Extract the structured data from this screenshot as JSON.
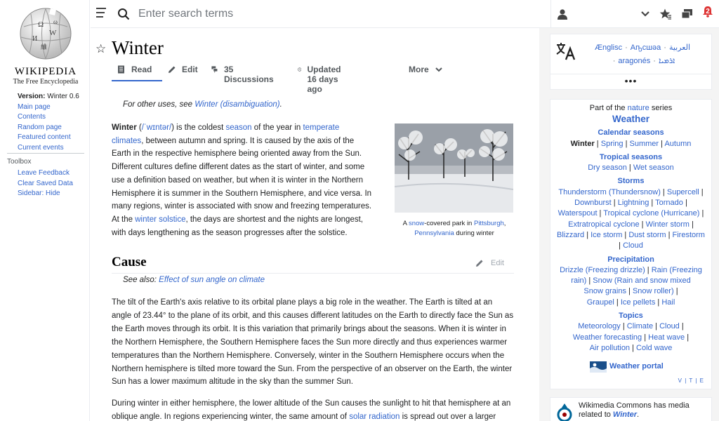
{
  "sidebar": {
    "wordmark": "Wikipedia",
    "tagline": "The Free Encyclopedia",
    "version_label": "Version:",
    "version_value": "Winter 0.6",
    "items": [
      {
        "label": "Main page"
      },
      {
        "label": "Contents"
      },
      {
        "label": "Random page"
      },
      {
        "label": "Featured content"
      },
      {
        "label": "Current events"
      }
    ],
    "toolbox_title": "Toolbox",
    "toolbox_items": [
      {
        "label": "Leave Feedback"
      },
      {
        "label": "Clear Saved Data"
      },
      {
        "label": "Sidebar: Hide"
      }
    ]
  },
  "header": {
    "search_placeholder": "Enter search terms",
    "notification_count": "2"
  },
  "article": {
    "title": "Winter",
    "tabs": [
      {
        "label": "Read"
      },
      {
        "label": "Edit"
      },
      {
        "label": "35 Discussions"
      },
      {
        "label": "Updated 16 days ago"
      },
      {
        "label": "More"
      }
    ],
    "hatnote_prefix": "For other uses, see ",
    "hatnote_link": "Winter (disambiguation)",
    "hatnote_suffix": ".",
    "lead": {
      "term": "Winter",
      "pron_open": " (",
      "pron_link": "/ˈwɪntər/",
      "pron_close": ") is the coldest ",
      "link_season": "season",
      "t1": " of the year in ",
      "link_temperate": "temperate climates",
      "t2": ", between autumn and spring. It is caused by the axis of the Earth in the respective hemisphere being oriented away from the Sun. Different cultures define different dates as the start of winter, and some use a definition based on weather, but when it is winter in the Northern Hemisphere it is summer in the Southern Hemisphere, and vice versa. In many regions, winter is associated with snow and freezing temperatures. At the ",
      "link_solstice": "winter solstice",
      "t3": ", the days are shortest and the nights are longest, with days lengthening as the season progresses after the solstice."
    },
    "thumb": {
      "c1": "A ",
      "link_snow": "snow",
      "c2": "-covered park in ",
      "link_pitt": "Pittsburgh",
      "c3": ", ",
      "link_penn": "Pennsylvania",
      "c4": " during winter"
    },
    "cause": {
      "heading": "Cause",
      "edit_label": "Edit",
      "seealso_prefix": "See also: ",
      "seealso_link": "Effect of sun angle on climate",
      "p1": "The tilt of the Earth's axis relative to its orbital plane plays a big role in the weather. The Earth is tilted at an angle of 23.44° to the plane of its orbit, and this causes different latitudes on the Earth to directly face the Sun as the Earth moves through its orbit. It is this variation that primarily brings about the seasons. When it is winter in the Northern Hemisphere, the Southern Hemisphere faces the Sun more directly and thus experiences warmer temperatures than the Northern Hemisphere. Conversely, winter in the Southern Hemisphere occurs when the Northern hemisphere is tilted more toward the Sun. From the perspective of an observer on the Earth, the winter Sun has a lower maximum altitude in the sky than the summer Sun.",
      "p2a": "During winter in either hemisphere, the lower altitude of the Sun causes the sunlight to hit that hemisphere at an oblique angle. In regions experiencing winter, the same amount of ",
      "p2_link": "solar radiation",
      "p2b": " is spread out over a larger area."
    }
  },
  "languages": {
    "items": [
      "Ænglisc",
      "Аҧсшәа",
      "العربية",
      "aragonés",
      "ܐܪܡܝܐ"
    ],
    "more": "•••"
  },
  "navbox": {
    "series_prefix": "Part of the ",
    "series_link": "nature",
    "series_suffix": " series",
    "title": "Weather",
    "groups": [
      {
        "heading": "Calendar seasons",
        "items": [
          "Winter",
          "Spring",
          "Summer",
          "Autumn"
        ]
      },
      {
        "heading": "Tropical seasons",
        "items": [
          "Dry season",
          "Wet season"
        ]
      },
      {
        "heading": "Storms",
        "items": [
          "Thunderstorm (Thundersnow)",
          "Supercell",
          "Downburst",
          "Lightning",
          "Tornado",
          "Waterspout",
          "Tropical cyclone (Hurricane)",
          "Extratropical cyclone",
          "Winter storm",
          "Blizzard",
          "Ice storm",
          "Dust storm",
          "Firestorm",
          "Cloud"
        ]
      },
      {
        "heading": "Precipitation",
        "items": [
          "Drizzle (Freezing drizzle)",
          "Rain (Freezing rain)",
          "Snow (Rain and snow mixed",
          "Snow grains",
          "Snow roller)",
          "Graupel",
          "Ice pellets",
          "Hail"
        ]
      },
      {
        "heading": "Topics",
        "items": [
          "Meteorology",
          "Climate",
          "Cloud",
          "Weather forecasting",
          "Heat wave",
          "Air pollution",
          "Cold wave"
        ]
      }
    ],
    "portal": "Weather portal",
    "vte": "V | T | E"
  },
  "commons": {
    "line1": "Wikimedia Commons has media",
    "line2_prefix": "related to ",
    "line2_link": "Winter",
    "line2_suffix": "."
  },
  "colors": {
    "link": "#3366cc",
    "accent": "#3366cc",
    "badge": "#dd3333"
  }
}
